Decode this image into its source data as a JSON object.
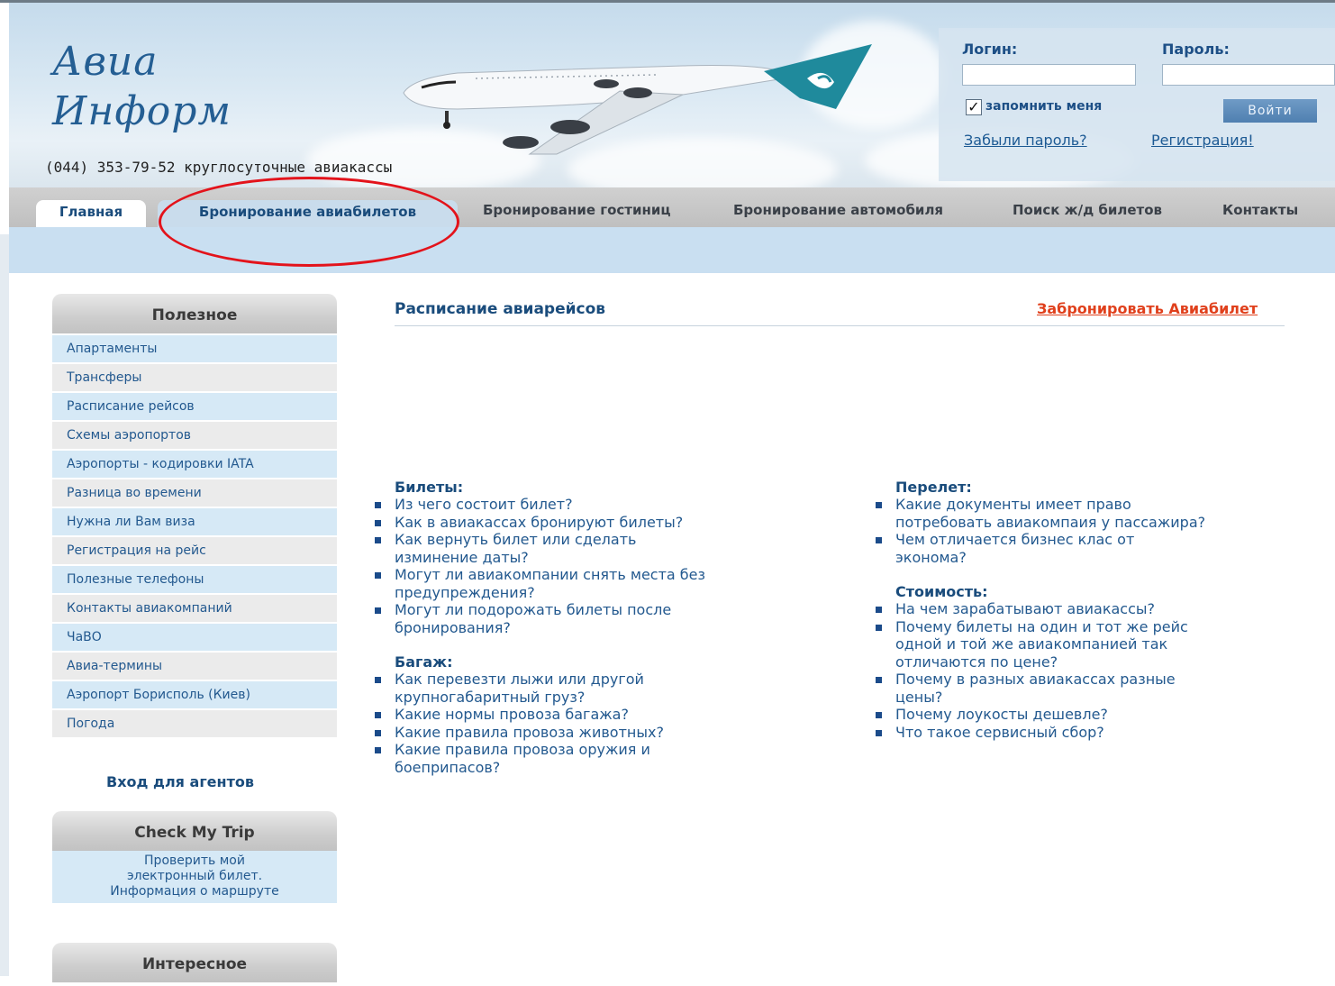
{
  "header": {
    "logo_line1": "Авиа",
    "logo_line2": "Информ",
    "phone": "(044) 353-79-52 круглосуточные авиакассы"
  },
  "login": {
    "login_label": "Логин:",
    "password_label": "Пароль:",
    "remember_checked": true,
    "remember_label": "запомнить меня",
    "submit_label": "Войти",
    "forgot_link": "Забыли пароль?",
    "register_link": "Регистрация!"
  },
  "nav": {
    "tabs": [
      {
        "label": "Главная",
        "active": true
      },
      {
        "label": "Бронирование авиабилетов",
        "active": false
      }
    ],
    "items": [
      "Бронирование гостиниц",
      "Бронирование автомобиля",
      "Поиск ж/д билетов",
      "Контакты"
    ]
  },
  "sidebar": {
    "useful_title": "Полезное",
    "items": [
      "Апартаменты",
      "Трансферы",
      "Расписание рейсов",
      "Схемы аэропортов",
      "Аэропорты - кодировки IATA",
      "Разница во времени",
      "Нужна ли Вам виза",
      "Регистрация на рейс",
      "Полезные телефоны",
      "Контакты авиакомпаний",
      "ЧаВО",
      "Авиа-термины",
      "Аэропорт Борисполь (Киев)",
      "Погода"
    ],
    "agents_link": "Вход для агентов",
    "checktrip_title": "Check My Trip",
    "checktrip_text": [
      "Проверить мой",
      "электронный билет.",
      "Информация о маршруте"
    ],
    "interesting_title": "Интересное"
  },
  "main": {
    "title": "Расписание авиарейсов",
    "book_link": "Забронировать Авиабилет",
    "left_col": [
      {
        "heading": "Билеты:",
        "items": [
          [
            "Из чего состоит билет?"
          ],
          [
            "Как в авиакассах бронируют билеты?"
          ],
          [
            "Как вернуть билет или сделать",
            "изминение даты?"
          ],
          [
            "Могут ли авиакомпании снять места без",
            "предупреждения?"
          ],
          [
            "Могут ли подорожать билеты после",
            "бронирования?"
          ]
        ]
      },
      {
        "heading": "Багаж:",
        "items": [
          [
            "Как перевезти лыжи или другой",
            "крупногабаритный груз?"
          ],
          [
            "Какие нормы провоза багажа?"
          ],
          [
            "Какие правила провоза животных?"
          ],
          [
            "Какие правила провоза оружия и",
            "боеприпасов?"
          ]
        ]
      }
    ],
    "right_col": [
      {
        "heading": "Перелет:",
        "items": [
          [
            "Какие документы имеет право",
            "потребовать авиакомпаия у пассажира?"
          ],
          [
            "Чем отличается бизнес клас от",
            "эконома?"
          ]
        ]
      },
      {
        "heading": "Стоимость:",
        "items": [
          [
            "На чем зарабатывают авиакассы?"
          ],
          [
            "Почему билеты на один и тот же рейс",
            "одной и той же авиакомпанией так",
            "отличаются по цене?"
          ],
          [
            "Почему в разных авиакассах разные",
            "цены?"
          ],
          [
            "Почему лоукосты дешевле?"
          ],
          [
            "Что такое сервисный сбор?"
          ]
        ]
      }
    ]
  },
  "colors": {
    "accent_red": "#e3131b",
    "link_blue": "#23598f",
    "book_link_orange": "#e0401c"
  },
  "icons": [
    "airplane-image",
    "checkbox-check-icon",
    "square-bullet-icon"
  ]
}
